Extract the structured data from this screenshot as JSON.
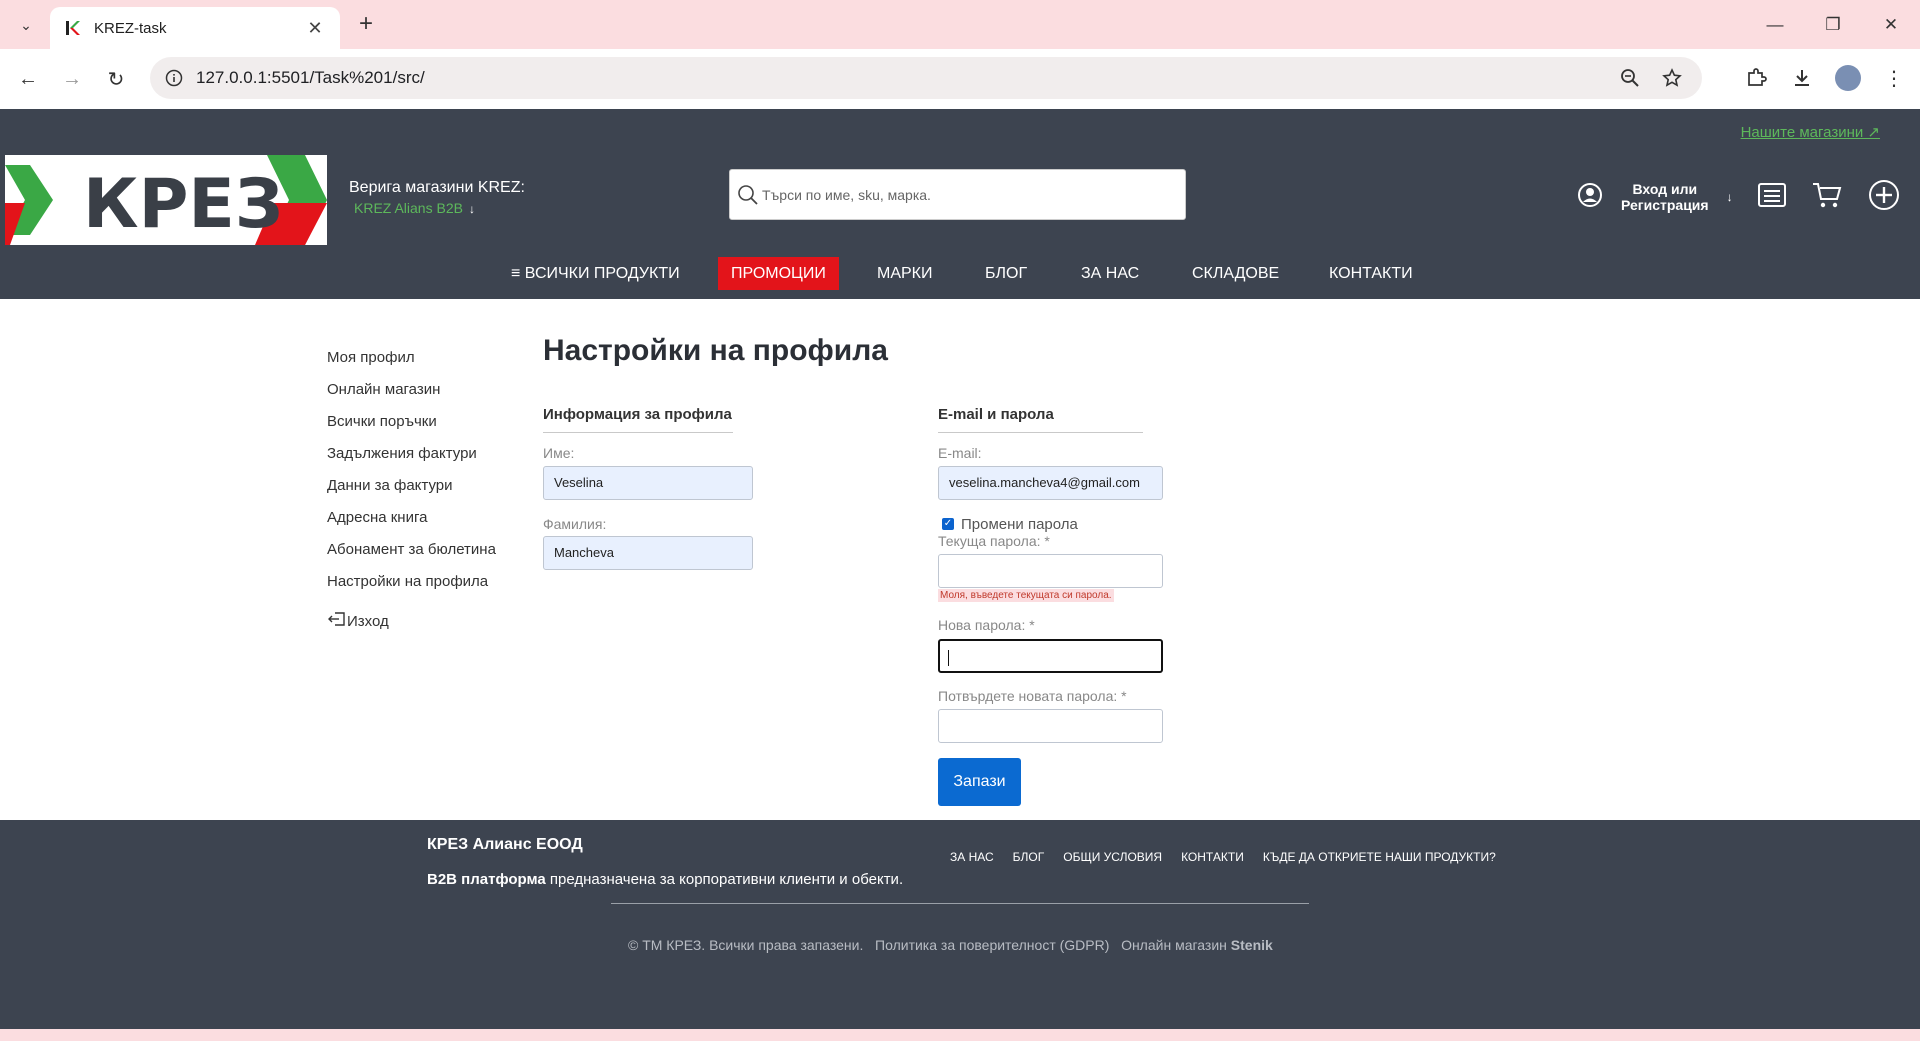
{
  "browser": {
    "tab_title": "KREZ-task",
    "url": "127.0.0.1:5501/Task%201/src/"
  },
  "topbar": {
    "stores_link": "Нашите магазини ↗"
  },
  "header": {
    "logo_text": "КРЕЗ",
    "chain_label": "Верига магазини KREZ:",
    "chain_value": "KREZ Alians B2B",
    "search_placeholder": "Търси по име, sku, марка.",
    "login_line1": "Вход или",
    "login_line2": "Регистрация"
  },
  "nav": {
    "all_products": "ВСИЧКИ ПРОДУКТИ",
    "promotions": "ПРОМОЦИИ",
    "brands": "МАРКИ",
    "blog": "БЛОГ",
    "about": "ЗА НАС",
    "warehouses": "СКЛАДОВЕ",
    "contacts": "КОНТАКТИ"
  },
  "sidebar": {
    "items": [
      "Моя профил",
      "Онлайн магазин",
      "Всички поръчки",
      "Задължения фактури",
      "Данни за фактури",
      "Адресна книга",
      "Абонамент за бюлетина",
      "Настройки на профила"
    ],
    "logout": "Изход"
  },
  "page": {
    "title": "Настройки на профила",
    "profile_section": "Информация за профила",
    "first_name_label": "Име:",
    "first_name_value": "Veselina",
    "last_name_label": "Фамилия:",
    "last_name_value": "Mancheva",
    "email_section": "E-mail и парола",
    "email_label": "E-mail:",
    "email_value": "veselina.mancheva4@gmail.com",
    "change_password_label": "Промени парола",
    "change_password_checked": true,
    "current_password_label": "Текуща парола: *",
    "current_password_error": "Моля, въведете текущата си парола.",
    "new_password_label": "Нова парола: *",
    "confirm_password_label": "Потвърдете новата парола: *",
    "save_label": "Запази"
  },
  "footer": {
    "company": "КРЕЗ Алианс ЕООД",
    "desc_bold": "B2B платформа",
    "desc_rest": " предназначена за корпоративни клиенти и обекти.",
    "links": [
      "ЗА НАС",
      "БЛОГ",
      "ОБЩИ УСЛОВИЯ",
      "КОНТАКТИ",
      "КЪДЕ ДА ОТКРИЕТЕ НАШИ ПРОДУКТИ?"
    ],
    "copyright": "© ТМ КРЕЗ. Всички права запазени.",
    "privacy": "Политика за поверителност (GDPR)",
    "online_store_prefix": "Онлайн магазин",
    "online_store_name": "Stenik"
  },
  "colors": {
    "header_bg": "#3d4450",
    "promo_red": "#e3141a",
    "accent_green": "#5db85b",
    "primary_blue": "#0b6ad1"
  }
}
